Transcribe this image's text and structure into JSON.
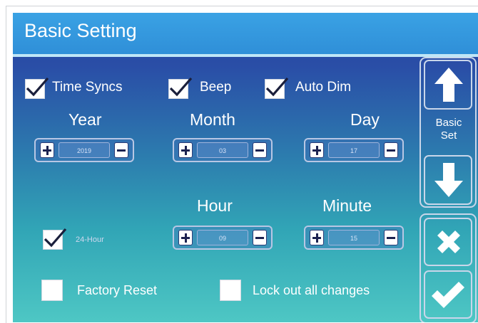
{
  "title": "Basic Setting",
  "options": {
    "time_syncs": {
      "label": "Time Syncs",
      "checked": true
    },
    "beep": {
      "label": "Beep",
      "checked": true
    },
    "auto_dim": {
      "label": "Auto Dim",
      "checked": true
    },
    "hour_24": {
      "label": "24-Hour",
      "checked": true
    },
    "factory_reset": {
      "label": "Factory Reset",
      "checked": false
    },
    "lock_out": {
      "label": "Lock out all changes",
      "checked": false
    }
  },
  "date": {
    "year": {
      "label": "Year",
      "value": "2019"
    },
    "month": {
      "label": "Month",
      "value": "03"
    },
    "day": {
      "label": "Day",
      "value": "17"
    }
  },
  "time": {
    "hour": {
      "label": "Hour",
      "value": "09"
    },
    "minute": {
      "label": "Minute",
      "value": "15"
    }
  },
  "side_panel": {
    "page_label_line1": "Basic",
    "page_label_line2": "Set",
    "icons": {
      "up": "up-arrow-icon",
      "down": "down-arrow-icon",
      "cancel": "close-icon",
      "confirm": "checkmark-icon"
    }
  },
  "colors": {
    "title_bar": "#3aa2e4",
    "background_top": "#253ea0",
    "background_bottom": "#4ec7c4",
    "button_face": "#ffffff",
    "icon_fill": "#1c2250"
  }
}
